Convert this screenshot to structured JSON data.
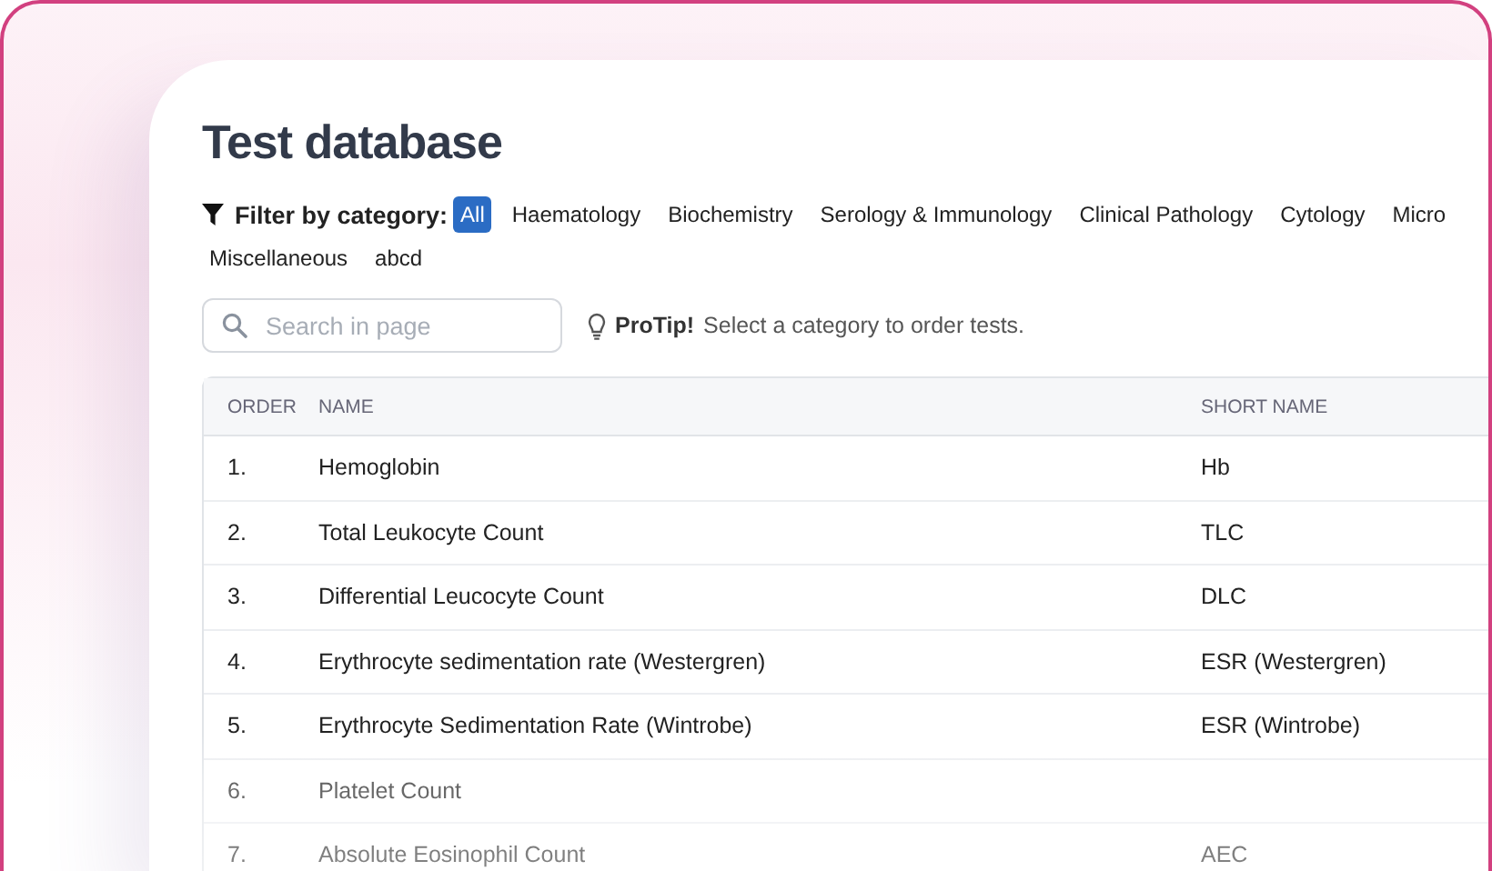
{
  "page": {
    "title": "Test database"
  },
  "filter": {
    "label": "Filter by category:",
    "categories": [
      {
        "label": "All",
        "selected": true
      },
      {
        "label": "Haematology",
        "selected": false
      },
      {
        "label": "Biochemistry",
        "selected": false
      },
      {
        "label": "Serology & Immunology",
        "selected": false
      },
      {
        "label": "Clinical Pathology",
        "selected": false
      },
      {
        "label": "Cytology",
        "selected": false
      },
      {
        "label": "Micro",
        "selected": false
      },
      {
        "label": "Miscellaneous",
        "selected": false
      },
      {
        "label": "abcd",
        "selected": false
      }
    ]
  },
  "search": {
    "placeholder": "Search in page"
  },
  "protip": {
    "label": "ProTip!",
    "text": "Select a category to order tests."
  },
  "table": {
    "columns": [
      "ORDER",
      "NAME",
      "SHORT NAME"
    ],
    "rows": [
      [
        "1.",
        "Hemoglobin",
        "Hb"
      ],
      [
        "2.",
        "Total Leukocyte Count",
        "TLC"
      ],
      [
        "3.",
        "Differential Leucocyte Count",
        "DLC"
      ],
      [
        "4.",
        "Erythrocyte sedimentation rate (Westergren)",
        "ESR (Westergren)"
      ],
      [
        "5.",
        "Erythrocyte Sedimentation Rate (Wintrobe)",
        "ESR (Wintrobe)"
      ],
      [
        "6.",
        "Platelet Count",
        ""
      ],
      [
        "7.",
        "Absolute Eosinophil Count",
        "AEC"
      ]
    ]
  }
}
